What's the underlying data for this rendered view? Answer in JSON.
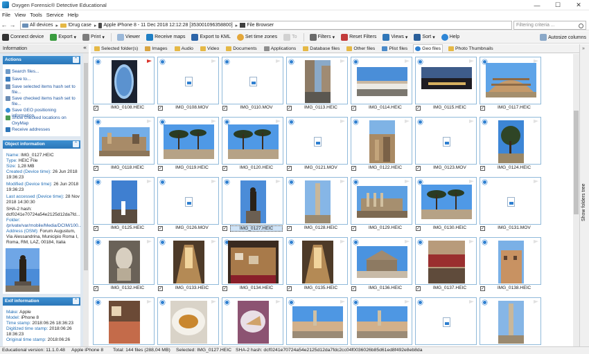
{
  "window": {
    "title": "Oxygen Forensic® Detective Educational",
    "controls": [
      "—",
      "☐",
      "✕"
    ]
  },
  "menu": [
    "File",
    "View",
    "Tools",
    "Service",
    "Help"
  ],
  "breadcrumbs": [
    "All devices",
    "!Drug case",
    "Apple iPhone 8 - 11 Dec 2018 12:12:28 [353001096358800]",
    "File Browser"
  ],
  "filter_placeholder": "Filtering criteria ...",
  "toolbar": {
    "connect": "Connect device",
    "export": "Export",
    "print": "Print",
    "viewer": "Viewer",
    "receive_maps": "Receive maps",
    "export_kml": "Export to KML",
    "set_time_zones": "Set time zones",
    "to": "To",
    "filters": "Filters",
    "reset_filters": "Reset Filters",
    "views": "Views",
    "sort": "Sort",
    "help": "Help",
    "autosize": "Autosize columns"
  },
  "left_header": "Information",
  "actions": {
    "title": "Actions",
    "items": [
      "Search files...",
      "Save to...",
      "Save selected items hash set to file...",
      "Save checked items hash set to file...",
      "Save GEO positioning information",
      "Show checked locations on OxyMap",
      "Receive addresses"
    ]
  },
  "object_info": {
    "title": "Object information",
    "name_label": "Name:",
    "name": "IMG_0127.HEIC",
    "type_label": "Type:",
    "type": "HEIC File",
    "size_label": "Size:",
    "size": "1,28 MB",
    "created_label": "Created (Device time):",
    "created": "26 Jun 2018 19:36:23",
    "modified_label": "Modified (Device time):",
    "modified": "26 Jun 2018 19:36:23",
    "accessed_label": "Last accessed (Device time):",
    "accessed": "28 Nov 2018 14:30:30",
    "sha_label": "SHA-2 hash:",
    "sha": "dcf0241e70724a54e2125d12da7fd...",
    "folder_label": "Folder:",
    "folder": "/private/var/mobile/Media/DCIM/100...",
    "address_label": "Address (OSM):",
    "address": "Forum Augustum, Via Alessandrina, Municipio Roma I, Roma, RM, LAZ, 00184, Italia"
  },
  "exif": {
    "title": "Exif information",
    "make_label": "Make:",
    "make": "Apple",
    "model_label": "Model:",
    "model": "iPhone 8",
    "timestamp_label": "Time stamp:",
    "timestamp": "2018:06:26 18:36:23",
    "digitized_label": "Digitized time stamp:",
    "digitized": "2018:06:26 18:36:23",
    "original_label": "Original time stamp:",
    "original": "2018:06:26"
  },
  "tabs": [
    "Selected folder(s)",
    "Images",
    "Audio",
    "Video",
    "Documents",
    "Applications",
    "Database files",
    "Other files",
    "Plist files",
    "Geo files",
    "Photo Thumbnails"
  ],
  "active_tab": "Geo files",
  "right_rail": "Show folders tree",
  "files": [
    {
      "name": "IMG_0108.HEIC",
      "kind": "window",
      "flag": true
    },
    {
      "name": "IMG_0108.MOV",
      "kind": "doc"
    },
    {
      "name": "IMG_0110.MOV",
      "kind": "doc"
    },
    {
      "name": "IMG_0113.HEIC",
      "kind": "street"
    },
    {
      "name": "IMG_0114.HEIC",
      "kind": "plaza"
    },
    {
      "name": "IMG_0115.HEIC",
      "kind": "night"
    },
    {
      "name": "IMG_0117.HEIC",
      "kind": "colosseum"
    },
    {
      "name": "IMG_0118.HEIC",
      "kind": "ruins"
    },
    {
      "name": "IMG_0119.HEIC",
      "kind": "pines"
    },
    {
      "name": "IMG_0120.HEIC",
      "kind": "pines"
    },
    {
      "name": "IMG_0121.MOV",
      "kind": "doc"
    },
    {
      "name": "IMG_0122.HEIC",
      "kind": "ruins_tall"
    },
    {
      "name": "IMG_0123.MOV",
      "kind": "doc"
    },
    {
      "name": "IMG_0124.HEIC",
      "kind": "tree_tall"
    },
    {
      "name": "IMG_0125.HEIC",
      "kind": "sky_tall"
    },
    {
      "name": "IMG_0126.MOV",
      "kind": "doc"
    },
    {
      "name": "IMG_0127.HEIC",
      "kind": "statue",
      "selected": true
    },
    {
      "name": "IMG_0128.HEIC",
      "kind": "column"
    },
    {
      "name": "IMG_0129.HEIC",
      "kind": "forum"
    },
    {
      "name": "IMG_0130.HEIC",
      "kind": "pines"
    },
    {
      "name": "IMG_0131.MOV",
      "kind": "doc"
    },
    {
      "name": "IMG_0132.HEIC",
      "kind": "sculpture"
    },
    {
      "name": "IMG_0133.HEIC",
      "kind": "interior"
    },
    {
      "name": "IMG_0134.HEIC",
      "kind": "crib"
    },
    {
      "name": "IMG_0135.HEIC",
      "kind": "interior"
    },
    {
      "name": "IMG_0136.HEIC",
      "kind": "pantheon"
    },
    {
      "name": "IMG_0137.HEIC",
      "kind": "cafe"
    },
    {
      "name": "IMG_0138.HEIC",
      "kind": "building"
    },
    {
      "name": "",
      "kind": "restaurant"
    },
    {
      "name": "",
      "kind": "pasta"
    },
    {
      "name": "",
      "kind": "dessert"
    },
    {
      "name": "",
      "kind": "piazza"
    },
    {
      "name": "",
      "kind": "piazza"
    },
    {
      "name": "",
      "kind": "doc"
    },
    {
      "name": "",
      "kind": "column"
    }
  ],
  "status": {
    "version": "Educational version: 11.1.0.48",
    "device": "Apple iPhone 8",
    "total": "Total: 144 files (288,04 MB)",
    "selected": "Selected: IMG_0127.HEIC",
    "hash": "SHA-2 hash: dcf0241e70724a54e2125d12da7fdc2cc04f0036026b85d61ed8f492e8eb8da"
  }
}
